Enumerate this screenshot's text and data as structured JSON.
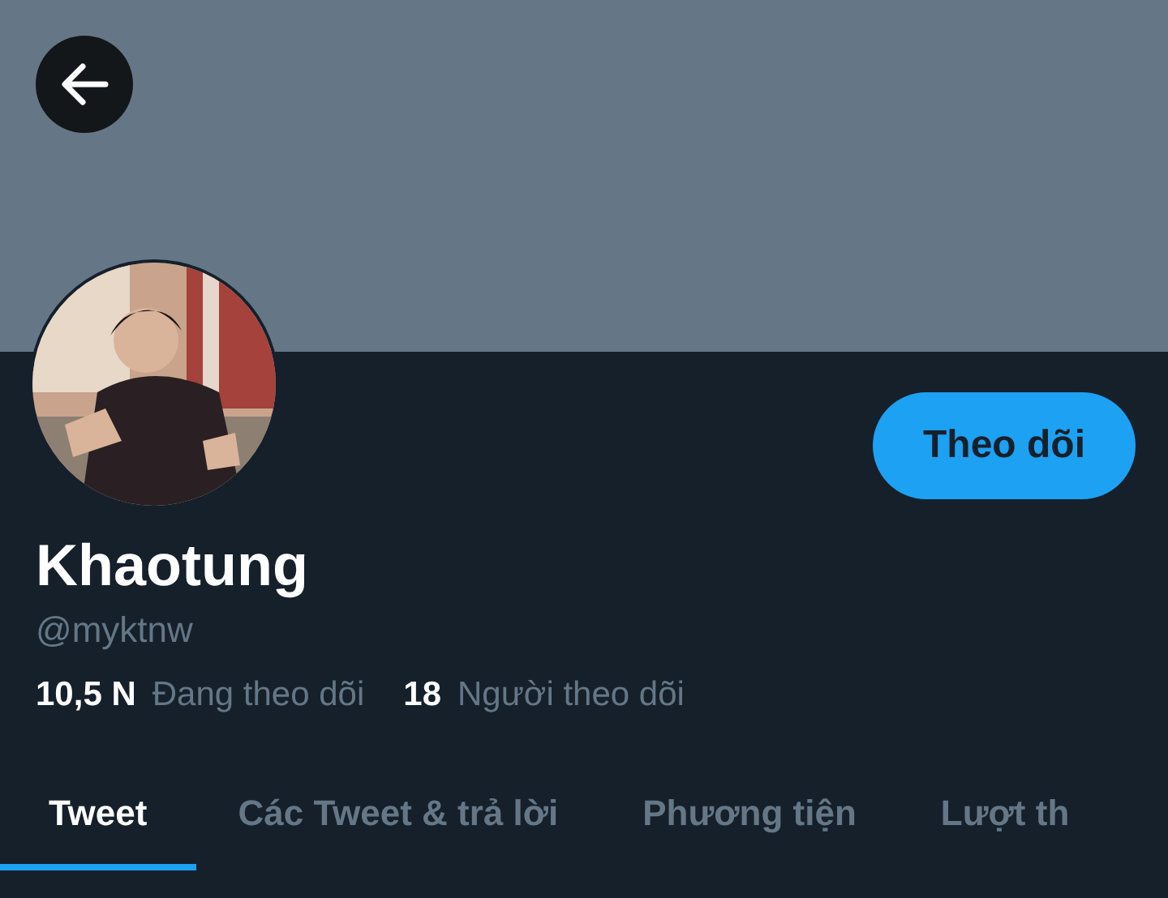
{
  "profile": {
    "name": "Khaotung",
    "handle": "@myktnw",
    "follow_button": "Theo dõi"
  },
  "stats": [
    {
      "count": "10,5 N",
      "label": "Đang theo dõi"
    },
    {
      "count": "18",
      "label": "Người theo dõi"
    }
  ],
  "tabs": [
    {
      "label": "Tweet",
      "selected": true
    },
    {
      "label": "Các Tweet & trả lời",
      "selected": false
    },
    {
      "label": "Phương tiện",
      "selected": false
    },
    {
      "label": "Lượt th",
      "selected": false
    }
  ]
}
